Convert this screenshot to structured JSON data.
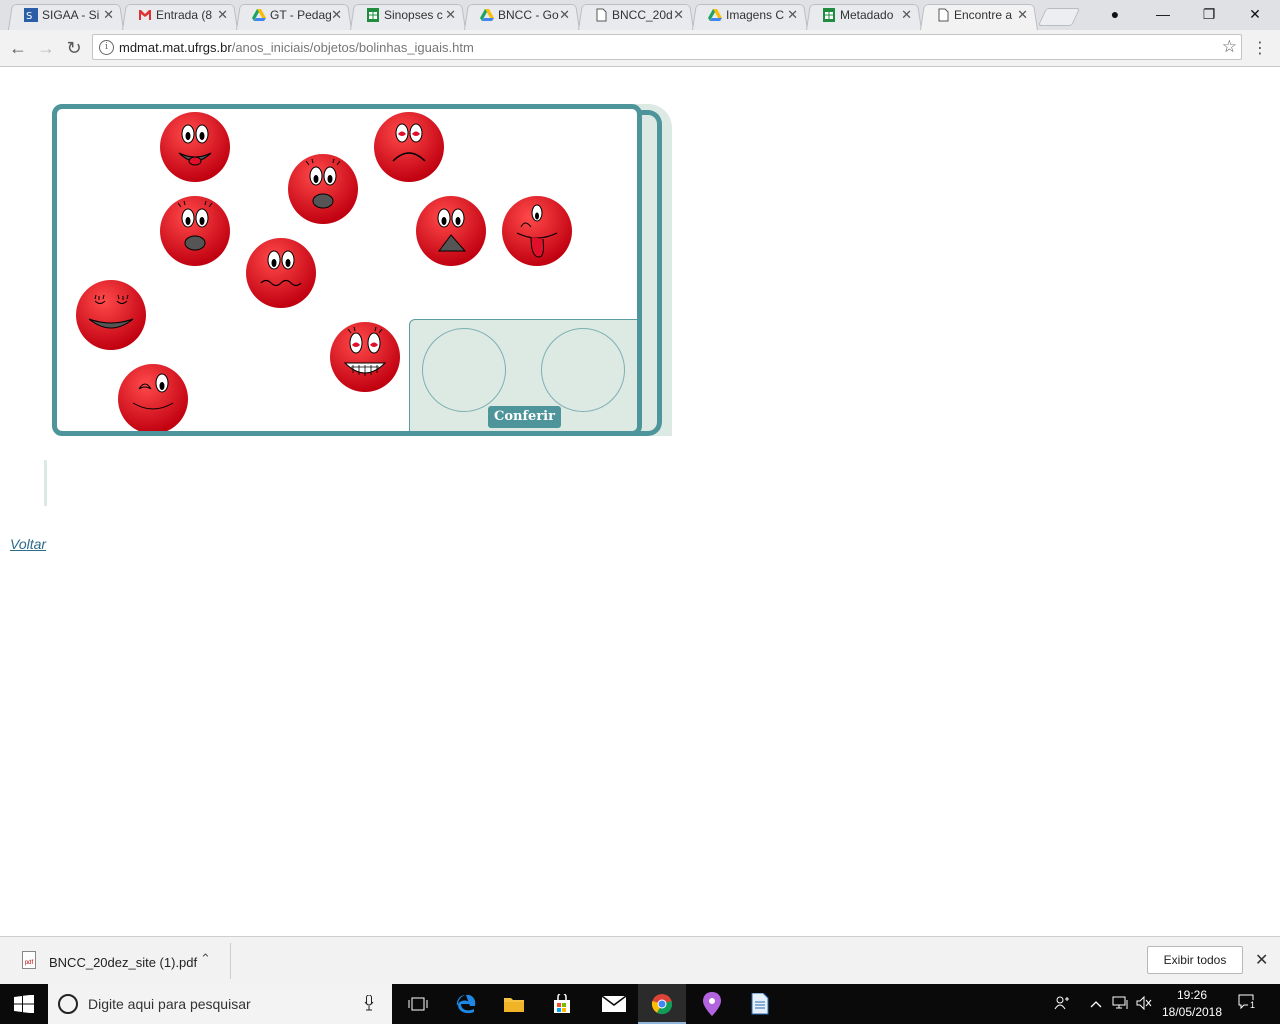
{
  "browser": {
    "tabs": [
      {
        "title": "SIGAA - Si",
        "icon": "sigaa-icon",
        "active": false
      },
      {
        "title": "Entrada (8",
        "icon": "gmail-icon",
        "active": false
      },
      {
        "title": "GT - Pedag",
        "icon": "drive-icon",
        "active": false
      },
      {
        "title": "Sinopses c",
        "icon": "sheets-icon",
        "active": false
      },
      {
        "title": "BNCC - Go",
        "icon": "drive-icon",
        "active": false
      },
      {
        "title": "BNCC_20d",
        "icon": "document-icon",
        "active": false
      },
      {
        "title": "Imagens C",
        "icon": "drive-icon",
        "active": false
      },
      {
        "title": "Metadado",
        "icon": "sheets-icon",
        "active": false
      },
      {
        "title": "Encontre a",
        "icon": "document-icon",
        "active": true
      }
    ],
    "tab_close": "✕",
    "url_host": "mdmat.mat.ufrgs.br",
    "url_path": "/anos_iniciais/objetos/bolinhas_iguais.htm",
    "info": "i",
    "back": "←",
    "forward": "→",
    "reload": "↻",
    "star": "☆",
    "menu": "⋮",
    "window": {
      "minimize": "—",
      "restore": "❐",
      "close": "✕",
      "profile": "●"
    }
  },
  "page": {
    "check_button": "Conferir",
    "back_link": "Voltar"
  },
  "download_shelf": {
    "filename": "BNCC_20dez_site (1).pdf",
    "file_badge": "pdf",
    "chevron": "⌃",
    "show_all": "Exibir todos",
    "close": "✕"
  },
  "taskbar": {
    "search_placeholder": "Digite aqui para pesquisar",
    "mic": "🎤",
    "time": "19:26",
    "date": "18/05/2018",
    "notif_count": "1"
  },
  "colors": {
    "ball_red": "#e0141c",
    "teal_border": "#4d959a",
    "panel_bg": "#dde9e3"
  }
}
